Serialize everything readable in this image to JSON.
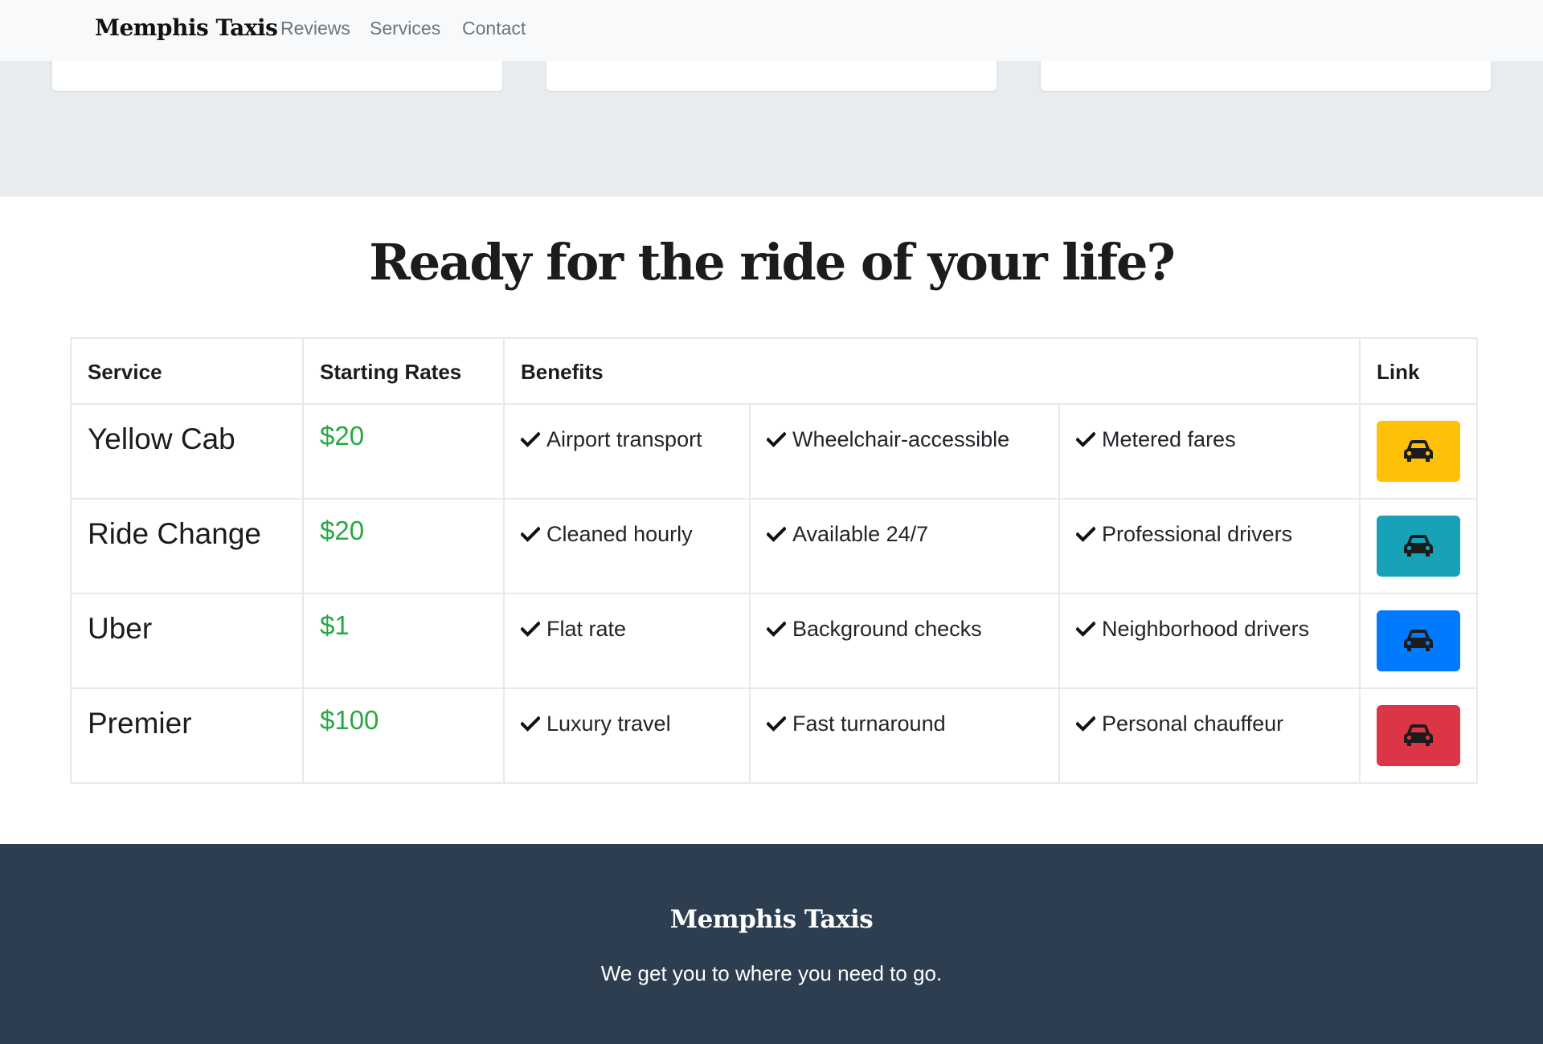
{
  "nav": {
    "brand": "Memphis Taxis",
    "links": [
      "Reviews",
      "Services",
      "Contact"
    ]
  },
  "main": {
    "heading": "Ready for the ride of your life?"
  },
  "table": {
    "headers": [
      "Service",
      "Starting Rates",
      "Benefits",
      "Link"
    ],
    "rows": [
      {
        "service": "Yellow Cab",
        "rate": "$20",
        "benefits": [
          "Airport transport",
          "Wheelchair-accessible",
          "Metered fares"
        ],
        "button_color": "#ffc107"
      },
      {
        "service": "Ride Change",
        "rate": "$20",
        "benefits": [
          "Cleaned hourly",
          "Available 24/7",
          "Professional drivers"
        ],
        "button_color": "#17a2b8"
      },
      {
        "service": "Uber",
        "rate": "$1",
        "benefits": [
          "Flat rate",
          "Background checks",
          "Neighborhood drivers"
        ],
        "button_color": "#007bff"
      },
      {
        "service": "Premier",
        "rate": "$100",
        "benefits": [
          "Luxury travel",
          "Fast turnaround",
          "Personal chauffeur"
        ],
        "button_color": "#dc3545"
      }
    ],
    "benefit_icon": "check-icon",
    "link_icon": "car-icon",
    "rate_color": "#28a745"
  },
  "footer": {
    "brand": "Memphis Taxis",
    "tagline": "We get you to where you need to go.",
    "background": "#2c3e50"
  }
}
